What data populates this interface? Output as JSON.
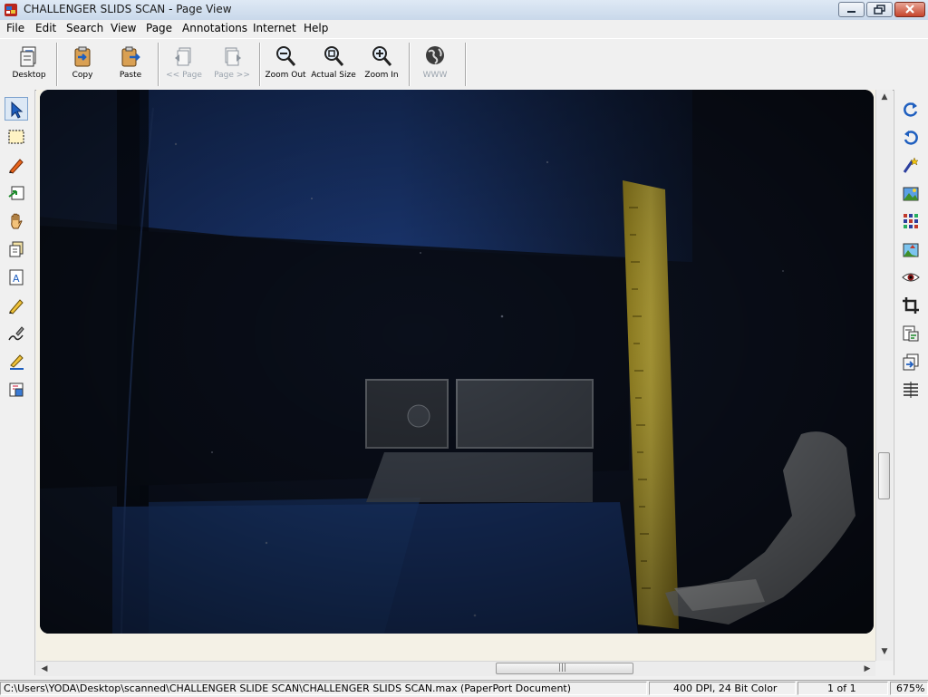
{
  "window": {
    "title": "CHALLENGER SLIDS SCAN - Page View",
    "app_icon": "paperport-icon",
    "controls": {
      "minimize": "minimize-icon",
      "maximize": "maximize-icon",
      "close": "close-icon"
    }
  },
  "menu": {
    "items": [
      "File",
      "Edit",
      "Search",
      "View",
      "Page",
      "Annotations",
      "Internet",
      "Help"
    ]
  },
  "toolbar": {
    "buttons": [
      {
        "label": "Desktop",
        "icon": "desktop-icon",
        "enabled": true
      },
      {
        "label": "Copy",
        "icon": "copy-icon",
        "enabled": true
      },
      {
        "label": "Paste",
        "icon": "paste-icon",
        "enabled": true
      },
      {
        "label": "<< Page",
        "icon": "previous-page-icon",
        "enabled": false
      },
      {
        "label": "Page >>",
        "icon": "next-page-icon",
        "enabled": false
      },
      {
        "label": "Zoom Out",
        "icon": "zoom-out-icon",
        "enabled": true
      },
      {
        "label": "Actual Size",
        "icon": "actual-size-icon",
        "enabled": true
      },
      {
        "label": "Zoom In",
        "icon": "zoom-in-icon",
        "enabled": true
      },
      {
        "label": "WWW",
        "icon": "globe-icon",
        "enabled": false
      }
    ]
  },
  "left_tools": [
    {
      "icon": "select-arrow-icon",
      "selected": true
    },
    {
      "icon": "marquee-select-icon"
    },
    {
      "icon": "highlighter-icon"
    },
    {
      "icon": "note-icon"
    },
    {
      "icon": "hand-pan-icon"
    },
    {
      "icon": "text-tool-icon"
    },
    {
      "icon": "text-box-icon"
    },
    {
      "icon": "pencil-icon"
    },
    {
      "icon": "freehand-icon"
    },
    {
      "icon": "line-tool-icon"
    },
    {
      "icon": "stamp-icon"
    }
  ],
  "right_tools": [
    {
      "icon": "rotate-right-icon"
    },
    {
      "icon": "rotate-left-icon"
    },
    {
      "icon": "enhance-wand-icon"
    },
    {
      "icon": "photo-edit-icon"
    },
    {
      "icon": "thumbnail-grid-icon"
    },
    {
      "icon": "image-adjust-icon"
    },
    {
      "icon": "view-eye-icon"
    },
    {
      "icon": "crop-icon"
    },
    {
      "icon": "clipboard-image-icon"
    },
    {
      "icon": "page-transfer-icon"
    },
    {
      "icon": "straighten-icon"
    }
  ],
  "document": {
    "content": "scanned-slide-photo"
  },
  "scrollbars": {
    "vertical_position": 0.64,
    "horizontal_position": 0.55
  },
  "status": {
    "path": "C:\\Users\\YODA\\Desktop\\scanned\\CHALLENGER SLIDE SCAN\\CHALLENGER SLIDS SCAN.max (PaperPort Document)",
    "resolution": "400 DPI, 24 Bit Color",
    "page": "1 of 1",
    "zoom": "675%"
  },
  "colors": {
    "title_gradient_top": "#dfe9f5",
    "close_red": "#c6452c",
    "icon_blue": "#1f5fbf",
    "slide_blue": "#1e3a73",
    "ruler_yellow": "#c9b53c"
  }
}
